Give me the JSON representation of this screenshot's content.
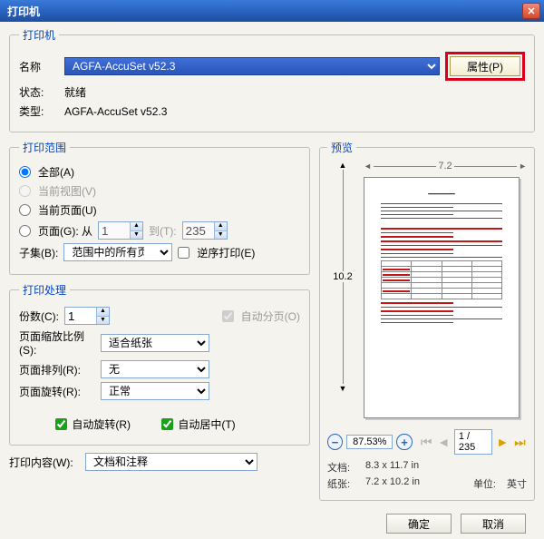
{
  "title": "打印机",
  "printer": {
    "legend": "打印机",
    "name_label": "名称",
    "name_value": "AGFA-AccuSet v52.3",
    "props_btn": "属性(P)",
    "status_label": "状态:",
    "status_value": "就绪",
    "type_label": "类型:",
    "type_value": "AGFA-AccuSet v52.3"
  },
  "range": {
    "legend": "打印范围",
    "all": "全部(A)",
    "current_view": "当前视图(V)",
    "current_page": "当前页面(U)",
    "pages": "页面(G): 从",
    "pages_from": "1",
    "to_label": "到(T):",
    "pages_to": "235",
    "subset_label": "子集(B):",
    "subset_value": "范围中的所有页",
    "reverse": "逆序打印(E)"
  },
  "handling": {
    "legend": "打印处理",
    "copies_label": "份数(C):",
    "copies_value": "1",
    "collate": "自动分页(O)",
    "scale_label": "页面缩放比例(S):",
    "scale_value": "适合纸张",
    "layout_label": "页面排列(R):",
    "layout_value": "无",
    "rotate_label": "页面旋转(R):",
    "rotate_value": "正常",
    "auto_rotate": "自动旋转(R)",
    "auto_center": "自动居中(T)"
  },
  "content": {
    "label": "打印内容(W):",
    "value": "文档和注释"
  },
  "preview": {
    "legend": "预览",
    "width": "7.2",
    "height": "10.2",
    "zoom": "87.53%",
    "page": "1 / 235",
    "doc_label": "文档:",
    "doc_value": "8.3 x 11.7 in",
    "paper_label": "纸张:",
    "paper_value": "7.2 x 10.2 in",
    "unit_label": "单位:",
    "unit_value": "英寸"
  },
  "buttons": {
    "ok": "确定",
    "cancel": "取消"
  }
}
